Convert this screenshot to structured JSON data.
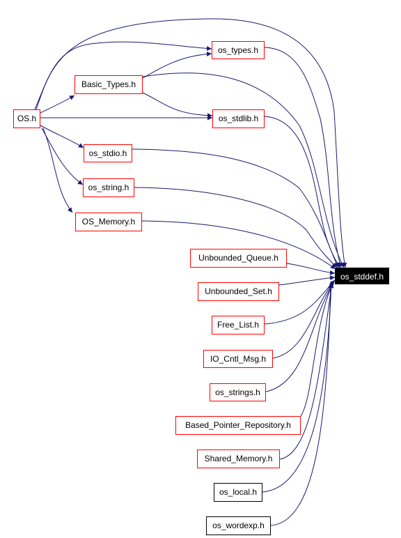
{
  "diagram": {
    "type": "include-dependency-graph",
    "edge_color": "#191970",
    "nodes": [
      {
        "id": "os_h",
        "label": "OS.h",
        "style": "red"
      },
      {
        "id": "basic_types",
        "label": "Basic_Types.h",
        "style": "red"
      },
      {
        "id": "os_types",
        "label": "os_types.h",
        "style": "red"
      },
      {
        "id": "os_stdlib",
        "label": "os_stdlib.h",
        "style": "red"
      },
      {
        "id": "os_stdio",
        "label": "os_stdio.h",
        "style": "red"
      },
      {
        "id": "os_string",
        "label": "os_string.h",
        "style": "red"
      },
      {
        "id": "os_memory",
        "label": "OS_Memory.h",
        "style": "red"
      },
      {
        "id": "unbounded_queue",
        "label": "Unbounded_Queue.h",
        "style": "red"
      },
      {
        "id": "unbounded_set",
        "label": "Unbounded_Set.h",
        "style": "red"
      },
      {
        "id": "free_list",
        "label": "Free_List.h",
        "style": "red"
      },
      {
        "id": "io_cntl_msg",
        "label": "IO_Cntl_Msg.h",
        "style": "red"
      },
      {
        "id": "os_strings",
        "label": "os_strings.h",
        "style": "red"
      },
      {
        "id": "based_pointer_repository",
        "label": "Based_Pointer_Repository.h",
        "style": "red"
      },
      {
        "id": "shared_memory",
        "label": "Shared_Memory.h",
        "style": "red"
      },
      {
        "id": "os_local",
        "label": "os_local.h",
        "style": "black"
      },
      {
        "id": "os_wordexp",
        "label": "os_wordexp.h",
        "style": "black"
      },
      {
        "id": "os_stddef",
        "label": "os_stddef.h",
        "style": "selected"
      }
    ],
    "edges": [
      {
        "from": "os_h",
        "to": "basic_types"
      },
      {
        "from": "os_h",
        "to": "os_types"
      },
      {
        "from": "os_h",
        "to": "os_stdlib"
      },
      {
        "from": "os_h",
        "to": "os_stdio"
      },
      {
        "from": "os_h",
        "to": "os_string"
      },
      {
        "from": "os_h",
        "to": "os_memory"
      },
      {
        "from": "os_h",
        "to": "os_stddef"
      },
      {
        "from": "basic_types",
        "to": "os_types"
      },
      {
        "from": "basic_types",
        "to": "os_stdlib"
      },
      {
        "from": "basic_types",
        "to": "os_stddef"
      },
      {
        "from": "os_types",
        "to": "os_stddef"
      },
      {
        "from": "os_stdlib",
        "to": "os_stddef"
      },
      {
        "from": "os_stdio",
        "to": "os_stddef"
      },
      {
        "from": "os_string",
        "to": "os_stddef"
      },
      {
        "from": "os_memory",
        "to": "os_stddef"
      },
      {
        "from": "unbounded_queue",
        "to": "os_stddef"
      },
      {
        "from": "unbounded_set",
        "to": "os_stddef"
      },
      {
        "from": "free_list",
        "to": "os_stddef"
      },
      {
        "from": "io_cntl_msg",
        "to": "os_stddef"
      },
      {
        "from": "os_strings",
        "to": "os_stddef"
      },
      {
        "from": "based_pointer_repository",
        "to": "os_stddef"
      },
      {
        "from": "shared_memory",
        "to": "os_stddef"
      },
      {
        "from": "os_local",
        "to": "os_stddef"
      },
      {
        "from": "os_wordexp",
        "to": "os_stddef"
      }
    ]
  }
}
